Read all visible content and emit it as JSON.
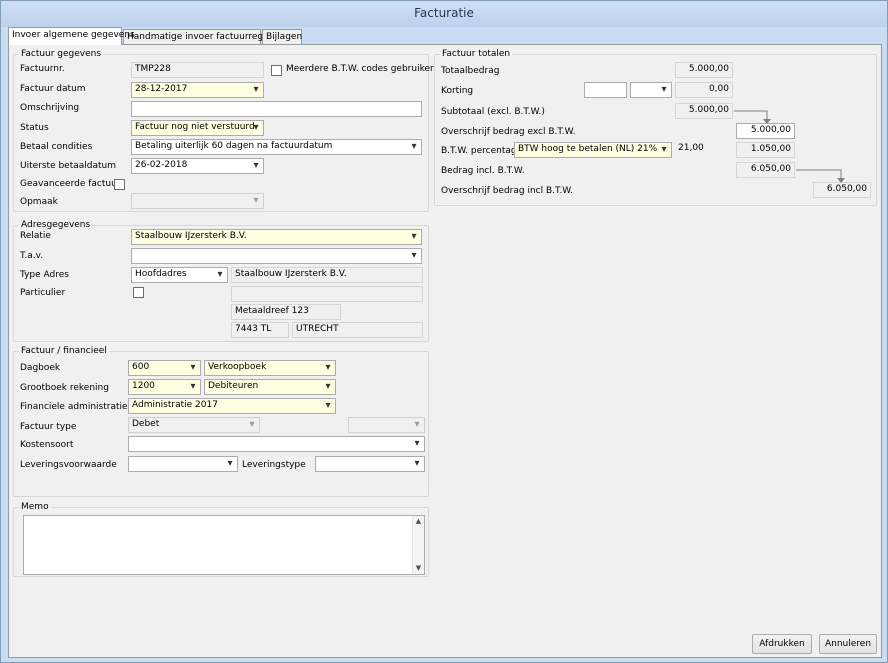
{
  "window": {
    "title": "Facturatie"
  },
  "tabs": [
    {
      "label": "Invoer algemene gegevens"
    },
    {
      "label": "Handmatige invoer factuurregels"
    },
    {
      "label": "Bijlagen"
    }
  ],
  "factuur_gegevens": {
    "group_title": "Factuur gegevens",
    "factuurnr_label": "Factuurnr.",
    "factuurnr_value": "TMP228",
    "meerdere_btw_label": "Meerdere B.T.W. codes gebruiken",
    "factuur_datum_label": "Factuur datum",
    "factuur_datum_value": "28-12-2017",
    "omschrijving_label": "Omschrijving",
    "omschrijving_value": "",
    "status_label": "Status",
    "status_value": "Factuur nog niet verstuurd",
    "betaal_condities_label": "Betaal condities",
    "betaal_condities_value": "Betaling uiterlijk 60 dagen na factuurdatum",
    "uiterste_betaaldatum_label": "Uiterste betaaldatum",
    "uiterste_betaaldatum_value": "26-02-2018",
    "geavanceerde_factuur_label": "Geavanceerde factuur",
    "opmaak_label": "Opmaak",
    "opmaak_value": ""
  },
  "adresgegevens": {
    "group_title": "Adresgegevens",
    "relatie_label": "Relatie",
    "relatie_value": "Staalbouw IJzersterk B.V.",
    "tav_label": "T.a.v.",
    "tav_value": "",
    "type_adres_label": "Type Adres",
    "type_adres_value": "Hoofdadres",
    "naam_value": "Staalbouw IJzersterk B.V.",
    "particulier_label": "Particulier",
    "adres_regel2": "",
    "straat": "Metaaldreef 123",
    "postcode": "7443 TL",
    "plaats": "UTRECHT"
  },
  "factuur_financieel": {
    "group_title": "Factuur / financieel",
    "dagboek_label": "Dagboek",
    "dagboek_code": "600",
    "dagboek_naam": "Verkoopboek",
    "grootboek_label": "Grootboek rekening",
    "grootboek_code": "1200",
    "grootboek_naam": "Debiteuren",
    "fin_admin_label": "Financiele administraties",
    "fin_admin_value": "Administratie 2017",
    "factuur_type_label": "Factuur type",
    "factuur_type_value": "Debet",
    "factuur_type_extra": "",
    "kostensoort_label": "Kostensoort",
    "kostensoort_value": "",
    "leveringsvoorwaarde_label": "Leveringsvoorwaarde",
    "leveringsvoorwaarde_value": "",
    "leveringstype_label": "Leveringstype",
    "leveringstype_value": ""
  },
  "memo": {
    "group_title": "Memo",
    "value": ""
  },
  "factuur_totalen": {
    "group_title": "Factuur totalen",
    "totaalbedrag_label": "Totaalbedrag",
    "totaalbedrag_value": "5.000,00",
    "korting_label": "Korting",
    "korting_input1": "",
    "korting_select": "",
    "korting_value": "0,00",
    "subtotaal_label": "Subtotaal (excl. B.T.W.)",
    "subtotaal_value": "5.000,00",
    "overschrijf_excl_label": "Overschrijf bedrag excl B.T.W.",
    "overschrijf_excl_value": "5.000,00",
    "btw_percentage_label": "B.T.W. percentage",
    "btw_percentage_value": "BTW hoog te betalen (NL) 21%",
    "btw_rate": "21,00",
    "btw_value": "1.050,00",
    "bedrag_incl_label": "Bedrag incl. B.T.W.",
    "bedrag_incl_value": "6.050,00",
    "overschrijf_incl_label": "Overschrijf bedrag incl B.T.W.",
    "overschrijf_incl_value": "6.050,00"
  },
  "buttons": {
    "afdrukken": "Afdrukken",
    "annuleren": "Annuleren"
  }
}
